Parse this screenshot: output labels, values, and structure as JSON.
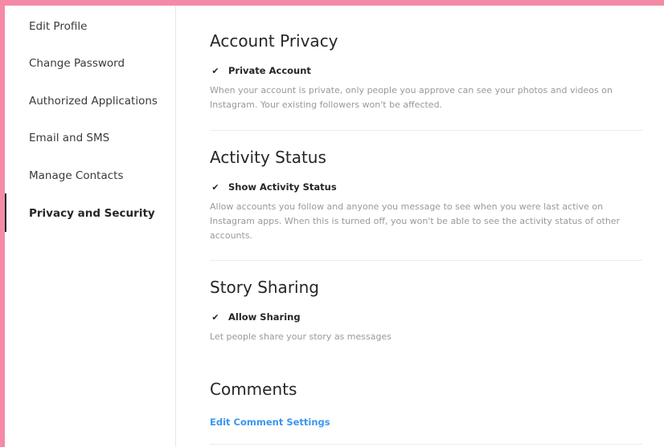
{
  "sidebar": {
    "items": [
      {
        "label": "Edit Profile"
      },
      {
        "label": "Change Password"
      },
      {
        "label": "Authorized Applications"
      },
      {
        "label": "Email and SMS"
      },
      {
        "label": "Manage Contacts"
      },
      {
        "label": "Privacy and Security"
      }
    ],
    "active_index": 5
  },
  "sections": {
    "account_privacy": {
      "title": "Account Privacy",
      "checkbox_label": "Private Account",
      "checked": true,
      "help": "When your account is private, only people you approve can see your photos and videos on Instagram. Your existing followers won't be affected."
    },
    "activity_status": {
      "title": "Activity Status",
      "checkbox_label": "Show Activity Status",
      "checked": true,
      "help": "Allow accounts you follow and anyone you message to see when you were last active on Instagram apps. When this is turned off, you won't be able to see the activity status of other accounts."
    },
    "story_sharing": {
      "title": "Story Sharing",
      "checkbox_label": "Allow Sharing",
      "checked": true,
      "help": "Let people share your story as messages"
    },
    "comments": {
      "title": "Comments",
      "link": "Edit Comment Settings"
    }
  },
  "check_glyph": "✔",
  "colors": {
    "accent": "#3897f0",
    "background_border": "#f48aa6",
    "muted_text": "#999999"
  }
}
